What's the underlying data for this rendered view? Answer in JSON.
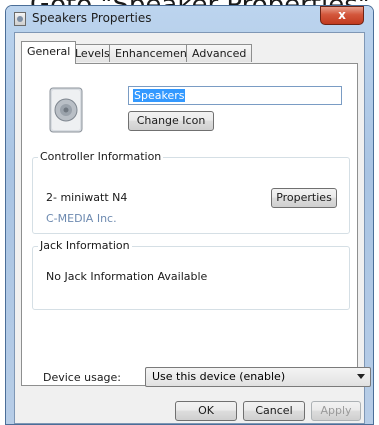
{
  "banner": {
    "text": "Goto \"Speaker Properties\" a"
  },
  "window": {
    "title": "Speakers Properties",
    "close_label": "x"
  },
  "tabs": [
    {
      "label": "General",
      "active": true
    },
    {
      "label": "Levels",
      "active": false
    },
    {
      "label": "Enhancements",
      "active": false
    },
    {
      "label": "Advanced",
      "active": false
    }
  ],
  "general": {
    "name_value": "Speakers",
    "change_icon_label": "Change Icon",
    "controller": {
      "group_label": "Controller Information",
      "device_name": "2- miniwatt N4",
      "vendor": "C-MEDIA Inc.",
      "properties_label": "Properties"
    },
    "jack": {
      "group_label": "Jack Information",
      "status": "No Jack Information Available"
    },
    "device_usage": {
      "label": "Device usage:",
      "selected": "Use this device (enable)"
    }
  },
  "footer": {
    "ok_label": "OK",
    "cancel_label": "Cancel",
    "apply_label": "Apply"
  },
  "colors": {
    "selection": "#3399ff",
    "close_button": "#c13a1f",
    "vendor_text": "#6d8ab0"
  }
}
